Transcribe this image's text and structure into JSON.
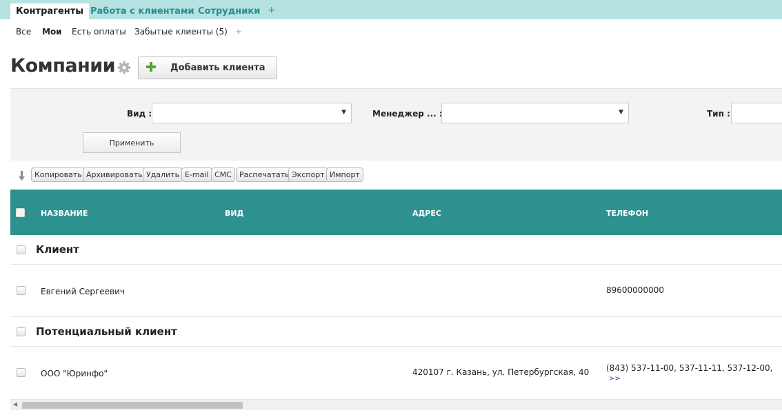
{
  "tabs": [
    {
      "label": "Контрагенты",
      "active": true
    },
    {
      "label": "Работа с клиентами",
      "active": false
    },
    {
      "label": "Сотрудники",
      "active": false
    }
  ],
  "tab_add": "+",
  "subnav": {
    "items": [
      {
        "label": "Все",
        "active": false
      },
      {
        "label": "Мои",
        "active": true
      },
      {
        "label": "Есть оплаты",
        "active": false
      },
      {
        "label": "Забытые клиенты (5)",
        "active": false
      }
    ],
    "add": "+"
  },
  "page": {
    "title": "Компании",
    "add_button": "Добавить клиента"
  },
  "filters": {
    "vid_label": "Вид :",
    "manager_label": "Менеджер ... :",
    "type_label": "Тип :",
    "vid_value": "",
    "manager_value": "",
    "type_value": "",
    "arrow": "▼",
    "apply": "Применить"
  },
  "actions": [
    "Копировать",
    "Архивировать",
    "Удалить",
    "E-mail",
    "СМС",
    "Распечатать",
    "Экспорт",
    "Импорт"
  ],
  "table": {
    "columns": [
      "НАЗВАНИЕ",
      "ВИД",
      "АДРЕС",
      "ТЕЛЕФОН"
    ],
    "groups": [
      {
        "title": "Клиент",
        "rows": [
          {
            "name": "Евгений Сергеевич",
            "vid": "",
            "address": "",
            "phone": "89600000000",
            "more": ""
          }
        ]
      },
      {
        "title": "Потенциальный клиент",
        "rows": [
          {
            "name": "ООО \"Юринфо\"",
            "vid": "",
            "address": "420107 г. Казань, ул. Петербургская, 40",
            "phone": "(843) 537-11-00, 537-11-11, 537-12-00,",
            "more": ">>"
          }
        ]
      }
    ]
  },
  "scrollbar": {
    "left_arrow": "◀"
  },
  "colors": {
    "accent": "#2d9190",
    "tabbar": "#b6e3e2",
    "add_icon": "#4aa82e"
  },
  "icons": {
    "settings": "gear-icon",
    "add": "plus-icon",
    "sort": "sort-down-icon"
  }
}
